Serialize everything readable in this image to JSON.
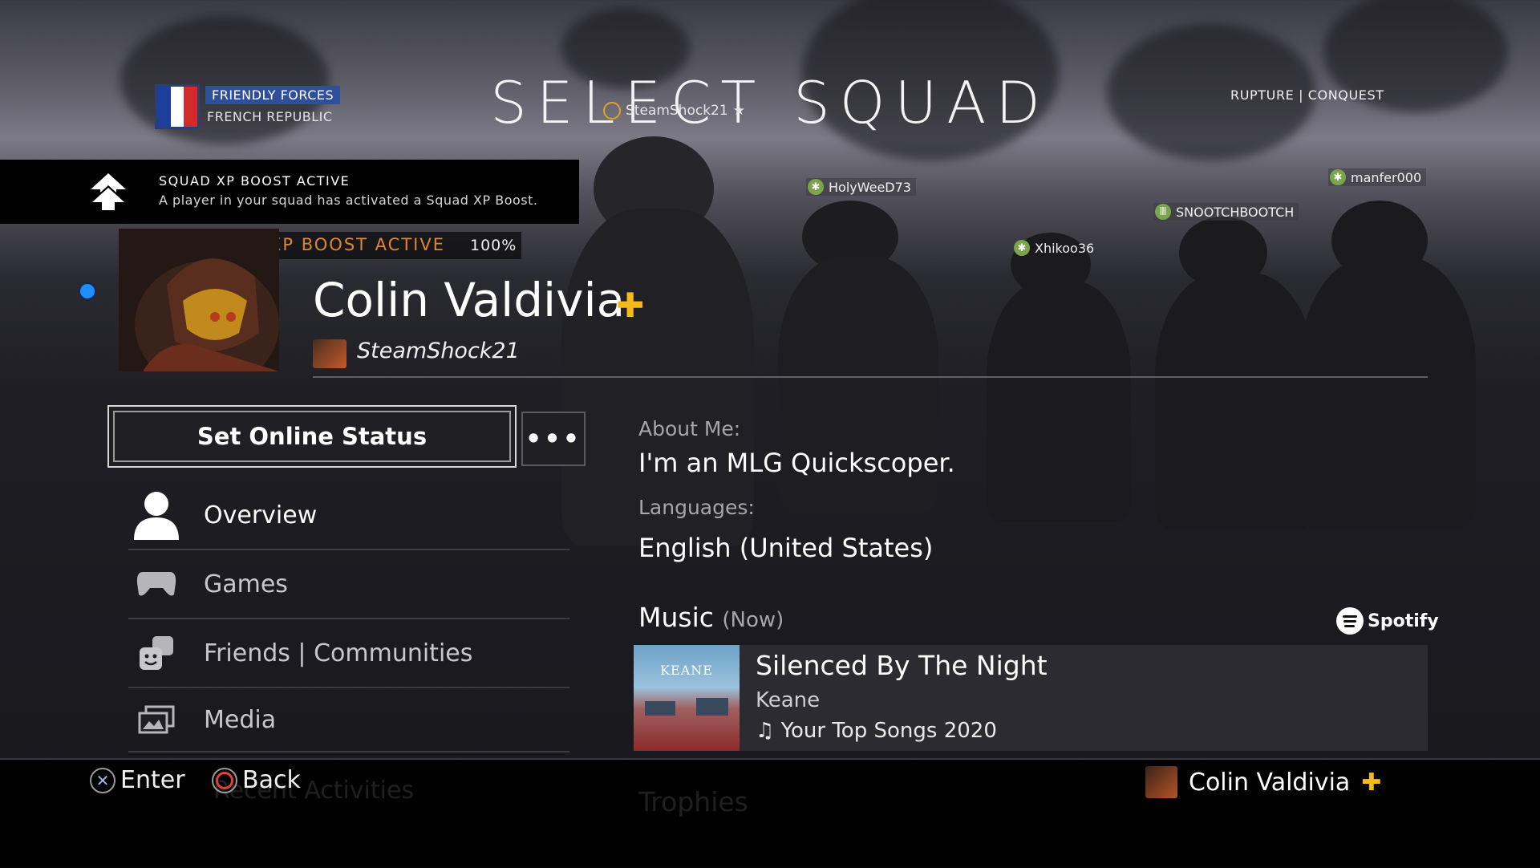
{
  "header": {
    "faction_tag": "FRIENDLY FORCES",
    "faction_name": "FRENCH REPUBLIC",
    "title": "SELECT SQUAD",
    "mode": "RUPTURE | CONQUEST",
    "squad_player": "SteamShock21"
  },
  "players": [
    "HolyWeeD73",
    "manfer000",
    "SNOOTCHBOOTCH",
    "Xhikoo36"
  ],
  "boost_banner": {
    "title": "SQUAD XP BOOST ACTIVE",
    "description": "A player in your squad has activated a Squad XP Boost.",
    "xp_label": "XP BOOST ACTIVE",
    "xp_percent": "100%"
  },
  "profile": {
    "name": "Colin Valdivia",
    "psn_id": "SteamShock21",
    "plus_icon": "ps-plus-icon",
    "online_color": "#1f8fff"
  },
  "actions": {
    "status_button": "Set Online Status",
    "more_button": "•••"
  },
  "menu": [
    {
      "label": "Overview",
      "icon": "person-icon"
    },
    {
      "label": "Games",
      "icon": "gamepad-icon"
    },
    {
      "label": "Friends | Communities",
      "icon": "friends-icon"
    },
    {
      "label": "Media",
      "icon": "media-icon"
    },
    {
      "label": "Recent Activities",
      "icon": "activity-icon"
    }
  ],
  "details": {
    "about_label": "About Me:",
    "about_value": "I'm an MLG Quickscoper.",
    "languages_label": "Languages:",
    "languages_value": "English (United States)",
    "music_label": "Music",
    "music_now": "(Now)",
    "spotify": "Spotify",
    "track": {
      "album_text": "KEANE",
      "name": "Silenced By The Night",
      "artist": "Keane",
      "playlist": "Your Top Songs 2020"
    },
    "trophies_label": "Trophies"
  },
  "footer": {
    "enter_label": "Enter",
    "back_label": "Back",
    "user_name": "Colin Valdivia"
  },
  "colors": {
    "accent_plus": "#f4b91d",
    "xp_orange": "#e0872a",
    "faction_blue": "#2f4f9a"
  }
}
